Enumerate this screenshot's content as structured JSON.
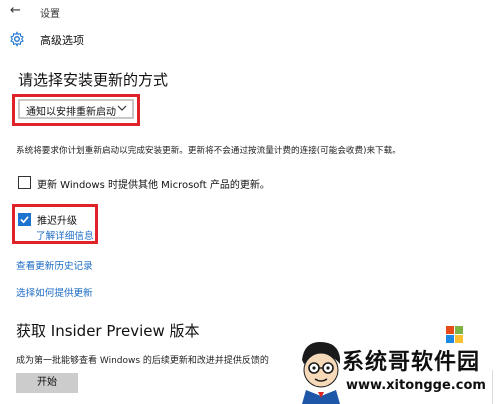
{
  "app_title": "设置",
  "page_title": "高级选项",
  "section_title": "请选择安装更新的方式",
  "update_mode": {
    "selected": "通知以安排重新启动"
  },
  "description": "系统将要求你计划重新启动以完成安装更新。更新将不会通过按流量计费的连接(可能会收费)来下载。",
  "options": [
    {
      "label": "更新 Windows 时提供其他 Microsoft 产品的更新。",
      "checked": false
    },
    {
      "label": "推迟升级",
      "checked": true
    }
  ],
  "learn_more": "了解详细信息",
  "links": {
    "history": "查看更新历史记录",
    "delivery": "选择如何提供更新"
  },
  "insider": {
    "title": "获取 Insider Preview 版本",
    "description": "成为第一批能够查看 Windows 的后续更新和改进并提供反馈的",
    "button": "开始"
  },
  "watermark": {
    "name": "系统哥软件园",
    "url": "www.xitongge.com"
  },
  "colors": {
    "accent": "#1d74d0",
    "link": "#1d6cc5",
    "highlight": "#e0232a"
  },
  "icons": {
    "back": "back-arrow-icon",
    "settings": "gear-icon",
    "dropdown": "chevron-down-icon",
    "check": "checkmark-icon"
  }
}
